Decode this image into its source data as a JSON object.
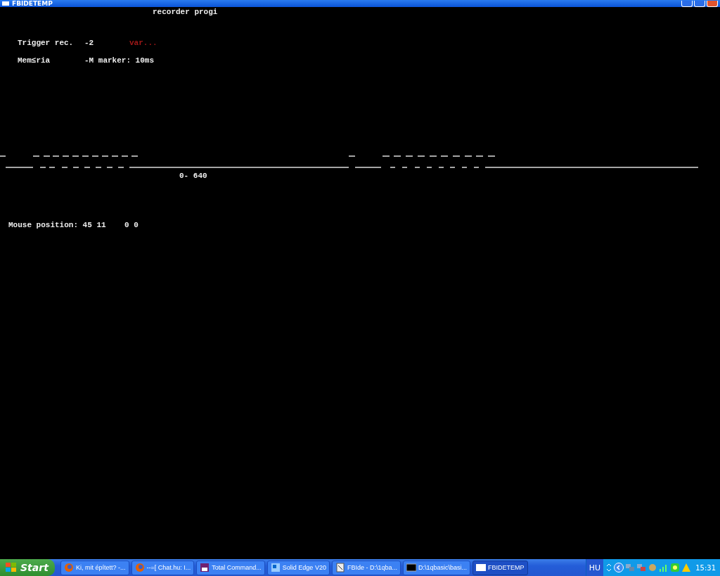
{
  "window": {
    "title": "FBIDETEMP"
  },
  "screen": {
    "heading": "recorder progi",
    "lines": [
      {
        "label": "Trigger rec.",
        "value": "-2",
        "note": "var..."
      },
      {
        "label": "Mem≤ria",
        "value": "-M marker: 10ms"
      }
    ],
    "scale_label": "0- 640",
    "mouse_position": "Mouse position: 45 11    0 0"
  },
  "taskbar": {
    "start": "Start",
    "tasks": [
      {
        "label": "Ki, mit épített? -...",
        "kind": "firefox",
        "selected": false
      },
      {
        "label": "--=[ Chat.hu: I...",
        "kind": "firefox",
        "selected": false
      },
      {
        "label": "Total Command...",
        "kind": "disk",
        "selected": false
      },
      {
        "label": "Solid Edge V20",
        "kind": "app",
        "selected": false
      },
      {
        "label": "FBIde - D:\\1qba...",
        "kind": "editor",
        "selected": false
      },
      {
        "label": "D:\\1qbasic\\basi...",
        "kind": "console",
        "selected": false
      },
      {
        "label": "FBIDETEMP",
        "kind": "window",
        "selected": true
      }
    ],
    "language": "HU",
    "clock": "15:31"
  }
}
